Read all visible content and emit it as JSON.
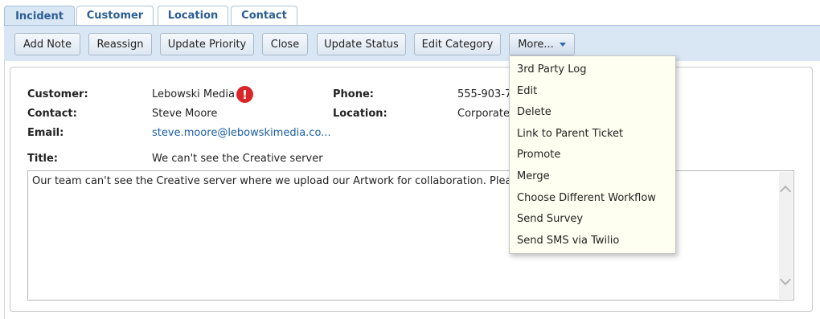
{
  "tabs": [
    {
      "label": "Incident",
      "active": true
    },
    {
      "label": "Customer"
    },
    {
      "label": "Location"
    },
    {
      "label": "Contact"
    }
  ],
  "toolbar": {
    "add_note": "Add Note",
    "reassign": "Reassign",
    "update_priority": "Update Priority",
    "close": "Close",
    "update_status": "Update Status",
    "edit_category": "Edit Category",
    "more": "More..."
  },
  "details": {
    "customer_label": "Customer:",
    "customer_value": "Lebowski Media",
    "alert_symbol": "!",
    "contact_label": "Contact:",
    "contact_value": "Steve Moore",
    "email_label": "Email:",
    "email_value": "steve.moore@lebowskimedia.co...",
    "phone_label": "Phone:",
    "phone_value": "555-903-7",
    "location_label": "Location:",
    "location_value": "Corporate",
    "title_label": "Title:",
    "title_value": "We can't see the Creative server",
    "description": "Our team can't see the Creative server where we upload our Artwork for collaboration. Please adv"
  },
  "more_menu": [
    "3rd Party Log",
    "Edit",
    "Delete",
    "Link to Parent Ticket",
    "Promote",
    "Merge",
    "Choose Different Workflow",
    "Send Survey",
    "Send SMS via Twilio"
  ],
  "colors": {
    "tab_text": "#2c5e93",
    "toolbar_band": "#d9e6f4",
    "alert": "#d9262b",
    "link": "#1a5fa8",
    "menu_bg": "#fefff0"
  }
}
